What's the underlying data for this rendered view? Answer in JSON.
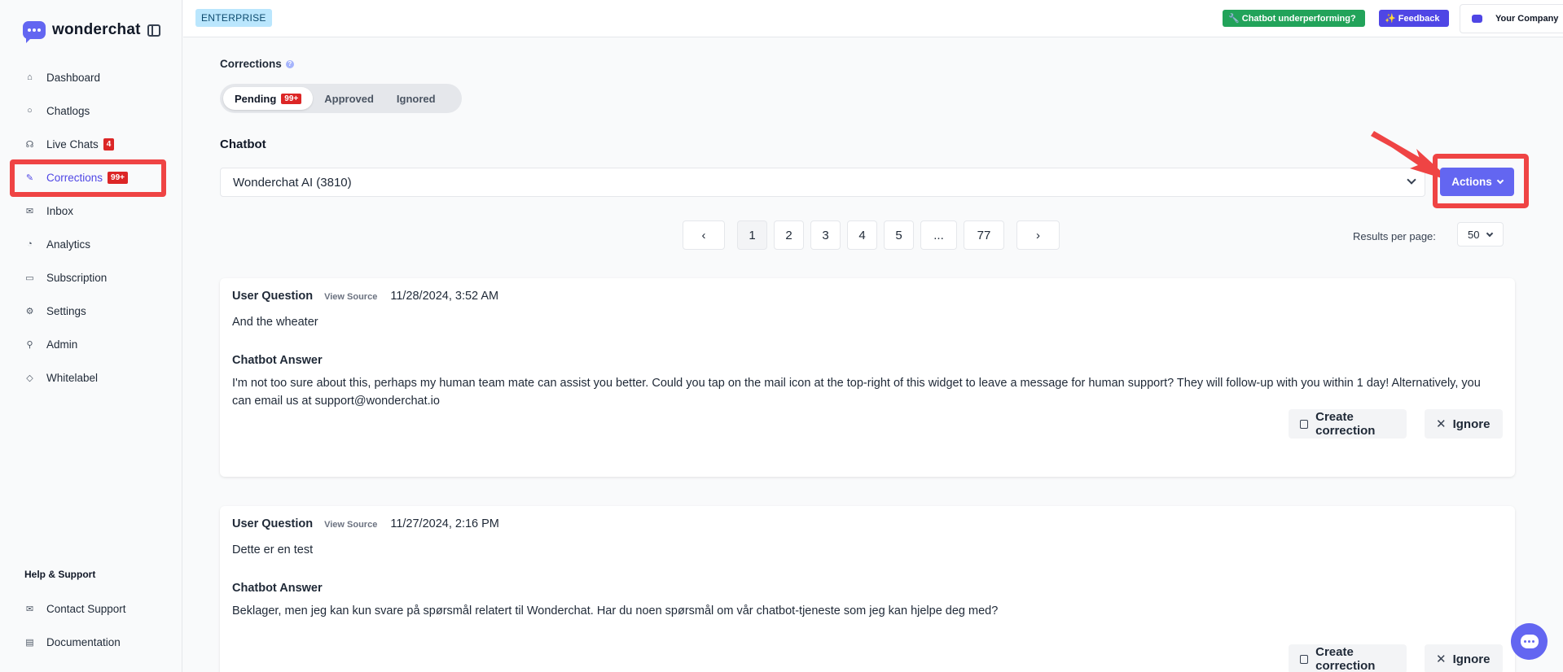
{
  "brand": {
    "name": "wonderchat"
  },
  "sidebar": {
    "items": [
      {
        "label": "Dashboard",
        "icon": "home-icon"
      },
      {
        "label": "Chatlogs",
        "icon": "chat-bubble-icon"
      },
      {
        "label": "Live Chats",
        "icon": "headset-icon",
        "badge": "4"
      },
      {
        "label": "Corrections",
        "icon": "pencil-icon",
        "badge": "99+",
        "active": true
      },
      {
        "label": "Inbox",
        "icon": "mail-icon"
      },
      {
        "label": "Analytics",
        "icon": "pie-chart-icon"
      },
      {
        "label": "Subscription",
        "icon": "credit-card-icon"
      },
      {
        "label": "Settings",
        "icon": "gear-icon"
      },
      {
        "label": "Admin",
        "icon": "user-check-icon"
      },
      {
        "label": "Whitelabel",
        "icon": "tag-icon"
      }
    ],
    "help_title": "Help & Support",
    "help_items": [
      {
        "label": "Contact Support",
        "icon": "mail-icon"
      },
      {
        "label": "Documentation",
        "icon": "document-icon"
      }
    ]
  },
  "topbar": {
    "plan": "ENTERPRISE",
    "underperforming": "🔧 Chatbot underperforming?",
    "feedback": "✨ Feedback",
    "company": "Your Company"
  },
  "main": {
    "section_label": "Corrections",
    "tabs": [
      {
        "label": "Pending",
        "badge": "99+",
        "active": true
      },
      {
        "label": "Approved"
      },
      {
        "label": "Ignored"
      }
    ],
    "chatbot_label": "Chatbot",
    "chatbot_selected": "Wonderchat AI (3810)",
    "actions_label": "Actions",
    "pagination": {
      "prev": "‹",
      "pages": [
        "1",
        "2",
        "3",
        "4",
        "5",
        "...",
        "77"
      ],
      "next": "›",
      "current": "1"
    },
    "results_per_page_label": "Results per page:",
    "results_per_page": "50"
  },
  "cards": [
    {
      "question_label": "User Question",
      "view_source": "View Source",
      "date": "11/28/2024, 3:52 AM",
      "question": "And the wheater",
      "answer_label": "Chatbot Answer",
      "answer": "I'm not too sure about this, perhaps my human team mate can assist you better. Could you tap on the mail icon at the top-right of this widget to leave a message for human support? They will follow-up with you within 1 day! Alternatively, you can email us at support@wonderchat.io",
      "create_label": "Create correction",
      "ignore_label": "Ignore"
    },
    {
      "question_label": "User Question",
      "view_source": "View Source",
      "date": "11/27/2024, 2:16 PM",
      "question": "Dette er en test",
      "answer_label": "Chatbot Answer",
      "answer": "Beklager, men jeg kan kun svare på spørsmål relatert til Wonderchat. Har du noen spørsmål om vår chatbot-tjeneste som jeg kan hjelpe deg med?",
      "create_label": "Create correction",
      "ignore_label": "Ignore"
    }
  ],
  "colors": {
    "accent": "#6366f1",
    "highlight": "#ef4444",
    "badge": "#dc2626",
    "success": "#22a35a"
  }
}
